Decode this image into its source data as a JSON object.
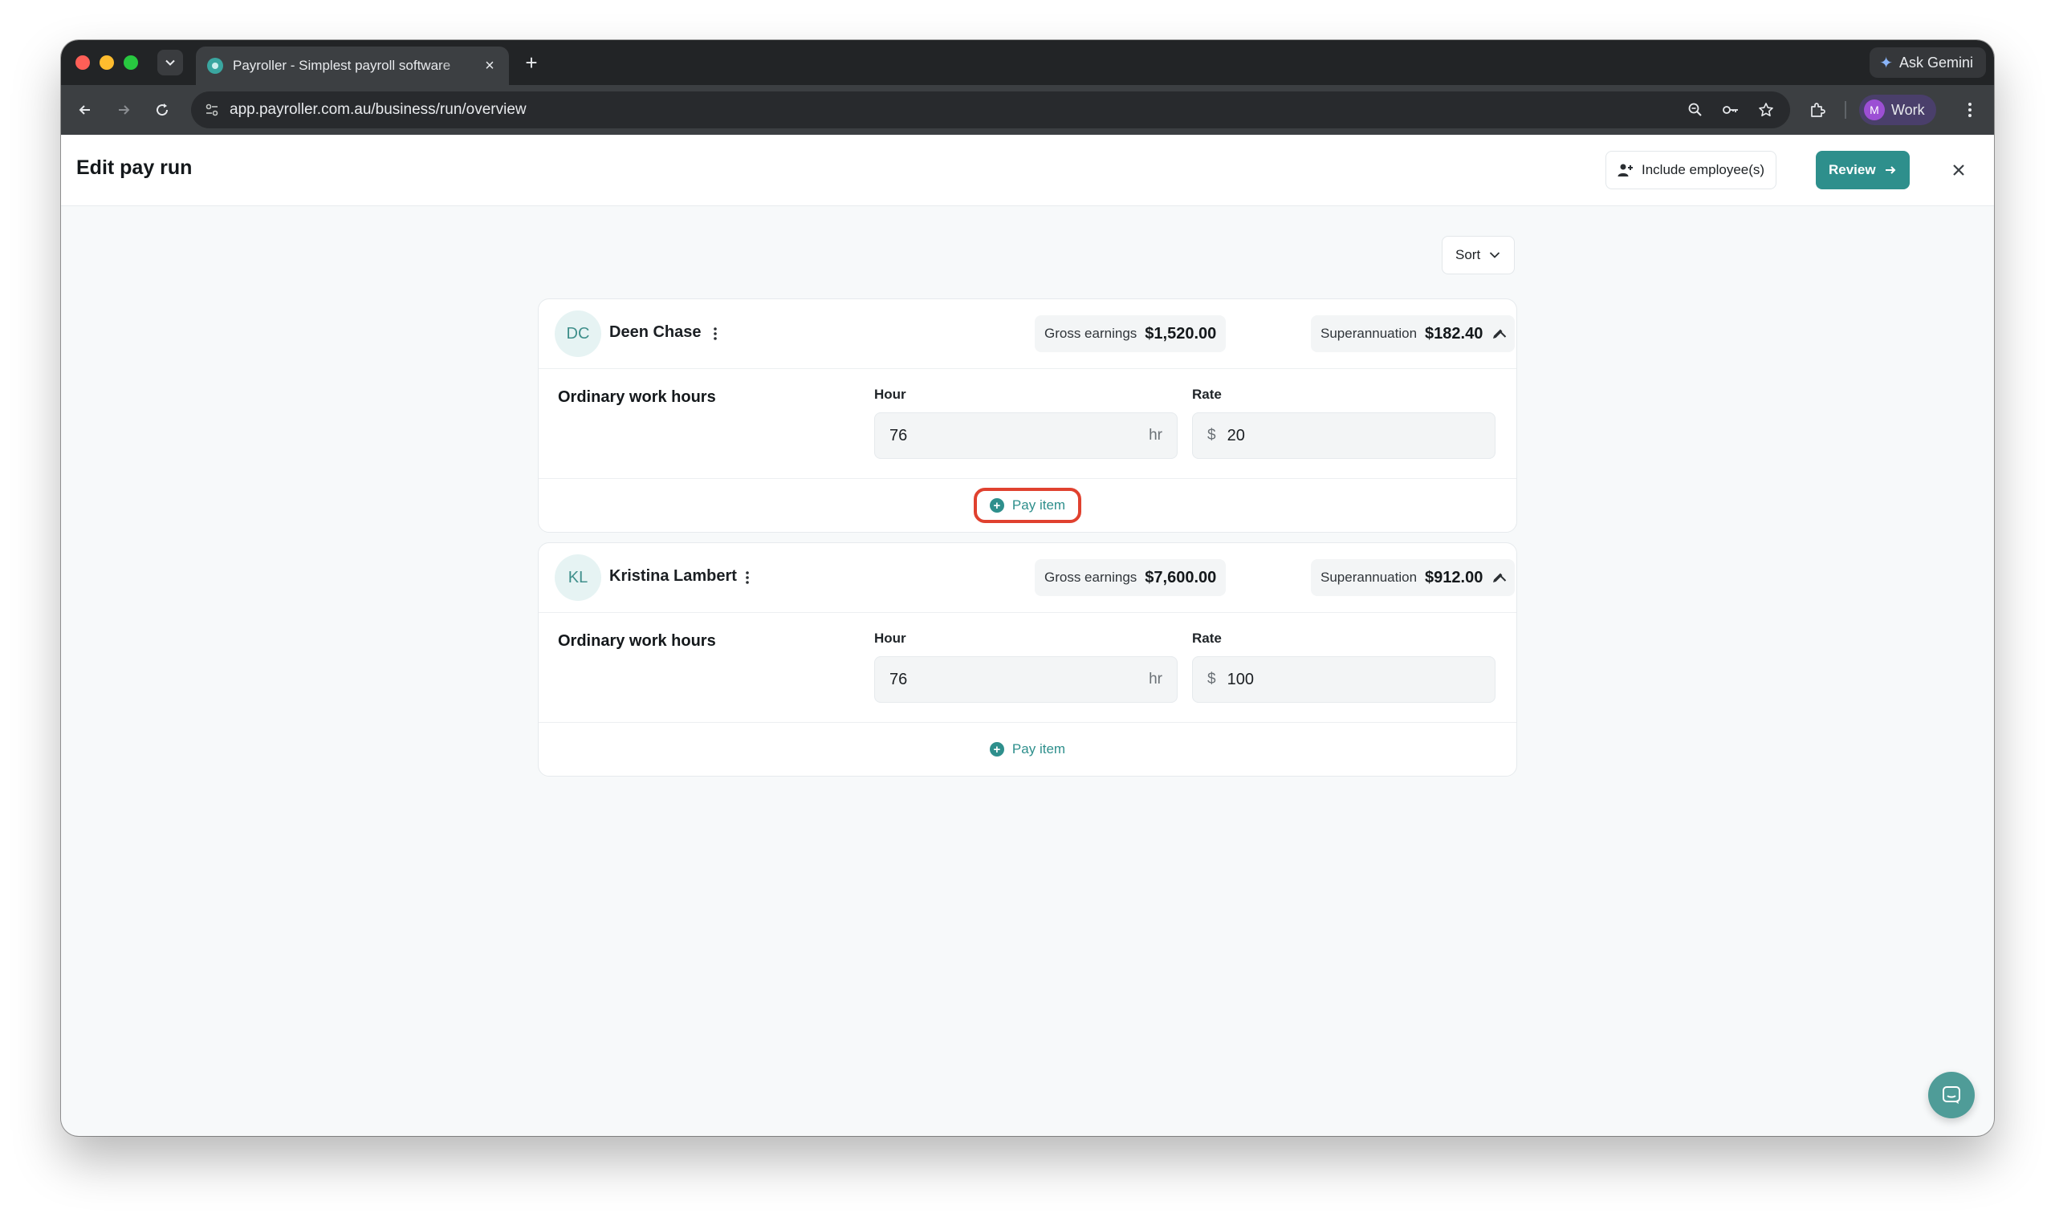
{
  "browser": {
    "tab_title": "Payroller - Simplest payroll software",
    "new_tab_label": "+",
    "gemini_label": "Ask Gemini",
    "url": "app.payroller.com.au/business/run/overview",
    "profile_initial": "M",
    "profile_label": "Work"
  },
  "header": {
    "title": "Edit pay run",
    "include_label": "Include employee(s)",
    "review_label": "Review"
  },
  "sort_label": "Sort",
  "employees": [
    {
      "initials": "DC",
      "name": "Deen Chase",
      "gross_label": "Gross earnings",
      "gross_value": "$1,520.00",
      "super_label": "Superannuation",
      "super_value": "$182.40",
      "row_label": "Ordinary work hours",
      "hour_label": "Hour",
      "hour_value": "76",
      "hour_suffix": "hr",
      "rate_label": "Rate",
      "rate_prefix": "$",
      "rate_value": "20",
      "add_label": "Pay item"
    },
    {
      "initials": "KL",
      "name": "Kristina Lambert",
      "gross_label": "Gross earnings",
      "gross_value": "$7,600.00",
      "super_label": "Superannuation",
      "super_value": "$912.00",
      "row_label": "Ordinary work hours",
      "hour_label": "Hour",
      "hour_value": "76",
      "hour_suffix": "hr",
      "rate_label": "Rate",
      "rate_prefix": "$",
      "rate_value": "100",
      "add_label": "Pay item"
    }
  ],
  "colors": {
    "accent": "#2e8f8c",
    "highlight": "#e0412f",
    "avatar_bg": "#e6f3f3"
  },
  "icons": [
    "search-icon",
    "key-icon",
    "star-icon",
    "extensions-icon",
    "kebab-icon",
    "chevron-up-icon",
    "pencil-icon",
    "close-icon",
    "chat-icon"
  ]
}
